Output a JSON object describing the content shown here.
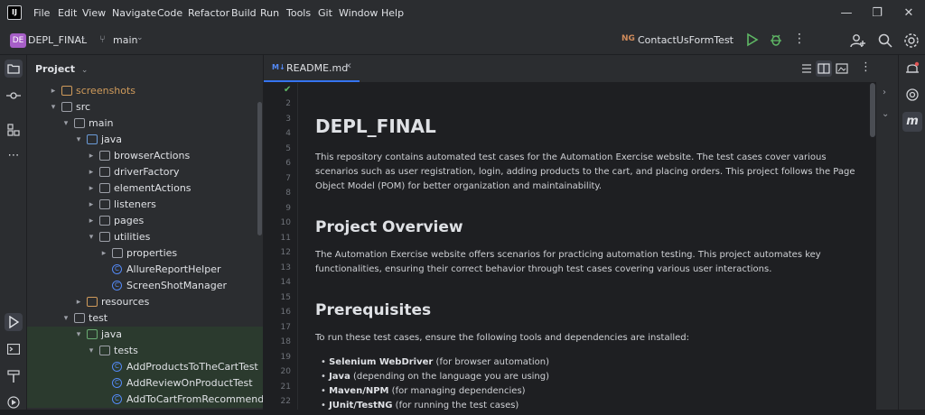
{
  "menu": [
    "File",
    "Edit",
    "View",
    "Navigate",
    "Code",
    "Refactor",
    "Build",
    "Run",
    "Tools",
    "Git",
    "Window",
    "Help"
  ],
  "toolbar": {
    "project_badge": "DE",
    "project_name": "DEPL_FINAL",
    "branch": "main",
    "run_config": "ContactUsFormTest"
  },
  "project_panel": {
    "title": "Project"
  },
  "tree": [
    {
      "label": "screenshots",
      "depth": 1,
      "arrow": "▸",
      "icon": "folder-orange",
      "color": "#d09b5b"
    },
    {
      "label": "src",
      "depth": 1,
      "arrow": "▾",
      "icon": "folder",
      "color": "#dfe1e5"
    },
    {
      "label": "main",
      "depth": 2,
      "arrow": "▾",
      "icon": "folder",
      "color": "#dfe1e5"
    },
    {
      "label": "java",
      "depth": 3,
      "arrow": "▾",
      "icon": "folder-blue",
      "color": "#dfe1e5"
    },
    {
      "label": "browserActions",
      "depth": 4,
      "arrow": "▸",
      "icon": "folder",
      "color": "#dfe1e5"
    },
    {
      "label": "driverFactory",
      "depth": 4,
      "arrow": "▸",
      "icon": "folder",
      "color": "#dfe1e5"
    },
    {
      "label": "elementActions",
      "depth": 4,
      "arrow": "▸",
      "icon": "folder",
      "color": "#dfe1e5"
    },
    {
      "label": "listeners",
      "depth": 4,
      "arrow": "▸",
      "icon": "folder",
      "color": "#dfe1e5"
    },
    {
      "label": "pages",
      "depth": 4,
      "arrow": "▸",
      "icon": "folder",
      "color": "#dfe1e5"
    },
    {
      "label": "utilities",
      "depth": 4,
      "arrow": "▾",
      "icon": "folder",
      "color": "#dfe1e5"
    },
    {
      "label": "properties",
      "depth": 5,
      "arrow": "▸",
      "icon": "folder",
      "color": "#dfe1e5"
    },
    {
      "label": "AllureReportHelper",
      "depth": 5,
      "arrow": "",
      "icon": "class",
      "color": "#dfe1e5"
    },
    {
      "label": "ScreenShotManager",
      "depth": 5,
      "arrow": "",
      "icon": "class",
      "color": "#dfe1e5"
    },
    {
      "label": "resources",
      "depth": 3,
      "arrow": "▸",
      "icon": "folder-orange",
      "color": "#dfe1e5"
    },
    {
      "label": "test",
      "depth": 2,
      "arrow": "▾",
      "icon": "folder",
      "color": "#dfe1e5"
    },
    {
      "label": "java",
      "depth": 3,
      "arrow": "▾",
      "icon": "folder-green",
      "color": "#dfe1e5",
      "green": true
    },
    {
      "label": "tests",
      "depth": 4,
      "arrow": "▾",
      "icon": "folder",
      "color": "#dfe1e5",
      "green": true
    },
    {
      "label": "AddProductsToTheCartTest",
      "depth": 5,
      "arrow": "",
      "icon": "class",
      "color": "#dfe1e5",
      "green": true
    },
    {
      "label": "AddReviewOnProductTest",
      "depth": 5,
      "arrow": "",
      "icon": "class",
      "color": "#dfe1e5",
      "green": true
    },
    {
      "label": "AddToCartFromRecommendedIt",
      "depth": 5,
      "arrow": "",
      "icon": "class",
      "color": "#dfe1e5",
      "green": true
    }
  ],
  "editor": {
    "tab_label": "README.md",
    "tab_badge": "M↓",
    "line_numbers": [
      "2",
      "3",
      "4",
      "5",
      "6",
      "7",
      "8",
      "9",
      "10",
      "11",
      "12",
      "13",
      "14",
      "15",
      "16",
      "17",
      "18",
      "19",
      "20",
      "21",
      "22"
    ],
    "h1": "DEPL_FINAL",
    "intro": "This repository contains automated test cases for the Automation Exercise website. The test cases cover various scenarios such as user registration, login, adding products to the cart, and placing orders. This project follows the Page Object Model (POM) for better organization and maintainability.",
    "overview_heading": "Project Overview",
    "overview_text": "The Automation Exercise website offers scenarios for practicing automation testing. This project automates key functionalities, ensuring their correct behavior through test cases covering various user interactions.",
    "prereq_heading": "Prerequisites",
    "prereq_text": "To run these test cases, ensure the following tools and dependencies are installed:",
    "prereq_items": [
      {
        "bold": "Selenium WebDriver",
        "rest": " (for browser automation)"
      },
      {
        "bold": "Java",
        "rest": " (depending on the language you are using)"
      },
      {
        "bold": "Maven/NPM",
        "rest": " (for managing dependencies)"
      },
      {
        "bold": "JUnit/TestNG",
        "rest": " (for running the test cases)"
      }
    ]
  },
  "colors": {
    "accent": "#3574f0",
    "run_green": "#5fb865",
    "badge_purple": "#a65fc7"
  }
}
